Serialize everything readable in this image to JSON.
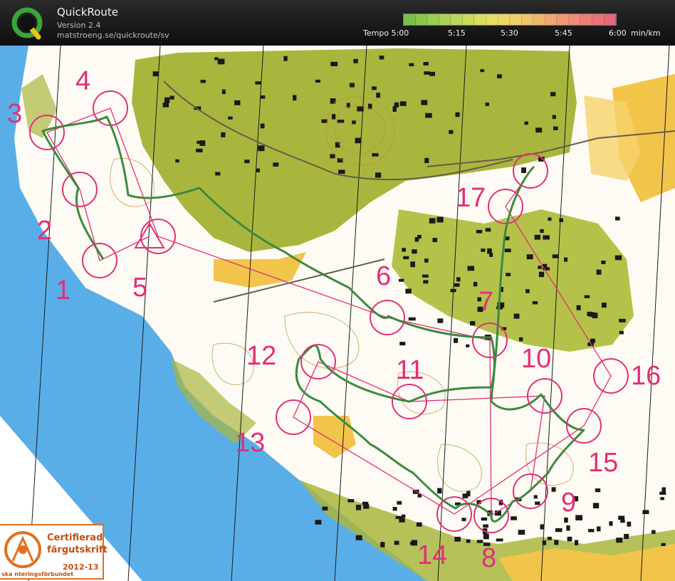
{
  "app": {
    "title": "QuickRoute",
    "version": "Version 2.4",
    "url": "matstroeng.se/quickroute/sv"
  },
  "legend": {
    "labels": [
      "Tempo 5:00",
      "5:15",
      "5:30",
      "5:45",
      "6:00",
      "min/km"
    ],
    "colors": [
      "#7cbf4a",
      "#8cc64e",
      "#9ccc52",
      "#acd256",
      "#bcd65a",
      "#ccda5e",
      "#dcde62",
      "#e6dc66",
      "#ecd66a",
      "#eecd6c",
      "#efc26e",
      "#f0b670",
      "#f0a872",
      "#ef9a74",
      "#ee8c76",
      "#ec7e78",
      "#ea717a",
      "#e8657c"
    ]
  },
  "controls": [
    {
      "num": "1"
    },
    {
      "num": "2"
    },
    {
      "num": "3"
    },
    {
      "num": "4"
    },
    {
      "num": "5"
    },
    {
      "num": "6"
    },
    {
      "num": "7"
    },
    {
      "num": "8"
    },
    {
      "num": "9"
    },
    {
      "num": "10"
    },
    {
      "num": "11"
    },
    {
      "num": "12"
    },
    {
      "num": "13"
    },
    {
      "num": "14"
    },
    {
      "num": "15"
    },
    {
      "num": "16"
    },
    {
      "num": "17"
    }
  ],
  "badge": {
    "line1": "Certifierad",
    "line2": "färgutskrift",
    "line3": "2012-13",
    "line4": "ska  nteringsförbundet"
  },
  "colors": {
    "water": "#4aa6e8",
    "forest": "#ffffff",
    "urban": "#a8b83c",
    "open": "#f2c040",
    "course": "#e0307a",
    "route": "#3a8a40"
  }
}
